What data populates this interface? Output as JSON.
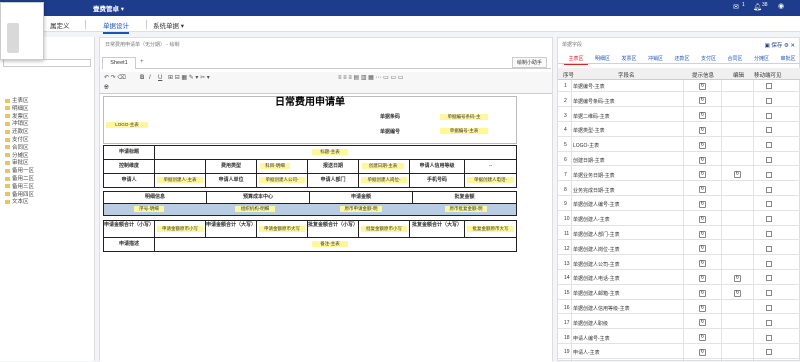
{
  "topbar": {
    "title": "壹费管卓 ▾",
    "badge1": "1",
    "badge2": "38"
  },
  "menu": {
    "items": [
      {
        "label": "属定义"
      },
      {
        "label": "单据设计"
      },
      {
        "label": "系统单据 ▾"
      }
    ]
  },
  "left_tree": [
    "主表区",
    "明细区",
    "发票区",
    "冲销区",
    "还款区",
    "支付区",
    "合同区",
    "分摊区",
    "审批区",
    "备用一区",
    "备用二区",
    "备用三区",
    "备用四区",
    "文本区"
  ],
  "center": {
    "title": "日常费用申请单（无分期） - 绘制",
    "sheet_tab": "Sheet1",
    "help_button": "绘制小助手",
    "font_name": "arial",
    "font_size": "12px",
    "form": {
      "title": "日常费用申请单",
      "logo": "LOGO-主表",
      "barcode_label": "单据条码",
      "barcode_value": "单据编号条码-主",
      "number_label": "单据编号",
      "number_value": "单据编号-主表",
      "apply_title_label": "申请标题",
      "apply_title_value": "标题-主表",
      "control_label": "控制维度",
      "fee_type_label": "费用类型",
      "fee_type_value": "科目-明细",
      "date_label": "报送日期",
      "date_value": "创建日期-主表",
      "credit_label": "申请人信用等级",
      "credit_value": "--",
      "applicant_label": "申请人",
      "applicant_value": "单据创建人-主表",
      "unit_label": "申请人单位",
      "unit_value": "单据创建人公司-",
      "dept_label": "申请人部门",
      "dept_value": "单据创建人岗位-",
      "phone_label": "手机号码",
      "phone_value": "单据创建人电话-",
      "detail_h1": "明细信息",
      "detail_h2": "预算成本中心",
      "detail_h3": "申请金额",
      "detail_h4": "批复金额",
      "detail_v1": "序号-明细",
      "detail_v2": "组织机构-明细",
      "detail_v3": "原币申请金额-明",
      "detail_v4": "原币批复金额-明",
      "total_small_label": "申请金额合计（小写）",
      "total_small_value": "申请金额原币小写",
      "total_big_label": "申请金额合计（大写）",
      "total_big_value": "申请金额原币大写",
      "approve_small_label": "批复金额合计（小写）",
      "approve_small_value": "批复金额原币小写",
      "approve_big_label": "批复金额合计（大写）",
      "approve_big_value": "批复金额原币大写",
      "desc_label": "申请描述",
      "desc_value": "备注-主表"
    }
  },
  "right": {
    "title": "单据字段",
    "save_label": "保存",
    "tabs": [
      "主表区",
      "明细区",
      "发票区",
      "冲销区",
      "还款区",
      "支付区",
      "合同区",
      "分摊区",
      "审批区"
    ],
    "headers": {
      "seq": "序号",
      "field": "字段名",
      "tip": "提示信息",
      "edit": "编辑",
      "mobile": "移动端可见"
    },
    "rows": [
      {
        "n": "1",
        "f": "单据编号-主表",
        "tip": true,
        "edit": false
      },
      {
        "n": "2",
        "f": "单据编号条码-主表",
        "tip": true,
        "edit": false
      },
      {
        "n": "3",
        "f": "单据二维码-主表",
        "tip": true,
        "edit": false
      },
      {
        "n": "4",
        "f": "单据类型-主表",
        "tip": true,
        "edit": false
      },
      {
        "n": "5",
        "f": "LOGO-主表",
        "tip": true,
        "edit": false
      },
      {
        "n": "6",
        "f": "创建日期-主表",
        "tip": true,
        "edit": false
      },
      {
        "n": "7",
        "f": "单据业务日期-主表",
        "tip": true,
        "edit": true
      },
      {
        "n": "8",
        "f": "业务完成日期-主表",
        "tip": true,
        "edit": false
      },
      {
        "n": "9",
        "f": "单据创建人编号-主表",
        "tip": true,
        "edit": false
      },
      {
        "n": "10",
        "f": "单据创建人-主表",
        "tip": true,
        "edit": false
      },
      {
        "n": "11",
        "f": "单据创建人部门-主表",
        "tip": true,
        "edit": false
      },
      {
        "n": "12",
        "f": "单据创建人岗位-主表",
        "tip": true,
        "edit": false
      },
      {
        "n": "13",
        "f": "单据创建人公司-主表",
        "tip": true,
        "edit": false
      },
      {
        "n": "14",
        "f": "单据创建人电话-主表",
        "tip": true,
        "edit": true
      },
      {
        "n": "15",
        "f": "单据创建人邮箱-主表",
        "tip": true,
        "edit": true
      },
      {
        "n": "16",
        "f": "单据创建人信用等级-主表",
        "tip": true,
        "edit": false
      },
      {
        "n": "17",
        "f": "单据创建人职级",
        "tip": true,
        "edit": false
      },
      {
        "n": "18",
        "f": "申请人编号-主表",
        "tip": true,
        "edit": false
      },
      {
        "n": "19",
        "f": "申请人-主表",
        "tip": true,
        "edit": false
      }
    ]
  },
  "colors": {
    "topbar": "#1e3c8c",
    "accent": "#1a53b8",
    "highlight": "#fff79a",
    "header_blue": "#b8cce4",
    "active_tab": "#dd2222"
  }
}
